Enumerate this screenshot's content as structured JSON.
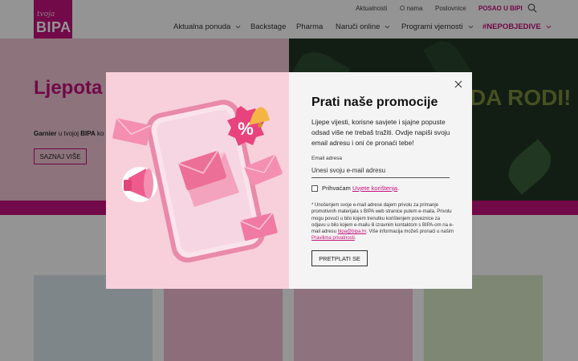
{
  "brand": {
    "tagline": "tvoja",
    "name": "BIPA",
    "accent": "#c4117c"
  },
  "top_links": [
    "Aktualnosti",
    "O nama",
    "Poslovnice",
    "POSAO U BIPI"
  ],
  "nav": [
    {
      "label": "Aktualna ponuda",
      "has_dropdown": true
    },
    {
      "label": "Backstage",
      "has_dropdown": false
    },
    {
      "label": "Pharma",
      "has_dropdown": false
    },
    {
      "label": "Naruči online",
      "has_dropdown": true
    },
    {
      "label": "Programi vjernosti",
      "has_dropdown": true
    },
    {
      "label": "#NEPOBJEDIVE",
      "has_dropdown": true
    }
  ],
  "hero": {
    "title": "Ljepota l prirodi",
    "subtitle_brand": "Garnier",
    "subtitle_text": " u tvojoj ",
    "subtitle_bipa": "BIPA",
    "subtitle_tail": " ko",
    "button": "SAZNAJ VIŠE",
    "right_text": "DA RODI!"
  },
  "modal": {
    "title": "Prati naše promocije",
    "description": "Lijepe vijesti, korisne savjete i sjajne popuste odsad više ne trebaš tražiti. Ovdje napiši svoju email adresu i oni će pronaći tebe!",
    "email_label": "Email adresa",
    "email_placeholder": "Unesi svoju e-mail adresu",
    "consent_prefix": "Prihvaćam ",
    "consent_link": "Uvjete korištenja",
    "consent_suffix": ".",
    "legal_1": "* Unošenjem svoje e-mail adrese dajem privolu za primanje promotivnih materijala s BIPA web stranice putem e-maila. Privolu mogu povući u bilo kojem trenutku korištenjem poveznice za odjavu u bilo kojem e-mailu ili izravnim kontaktom s BIPA-om na e-mail adresu ",
    "legal_email": "bipa@bipa.hr",
    "legal_2": ". Više informacija možeš pronaći u našim ",
    "legal_link": "Pravilima privatnosti",
    "legal_3": ".",
    "submit": "PRETPLATI SE"
  }
}
